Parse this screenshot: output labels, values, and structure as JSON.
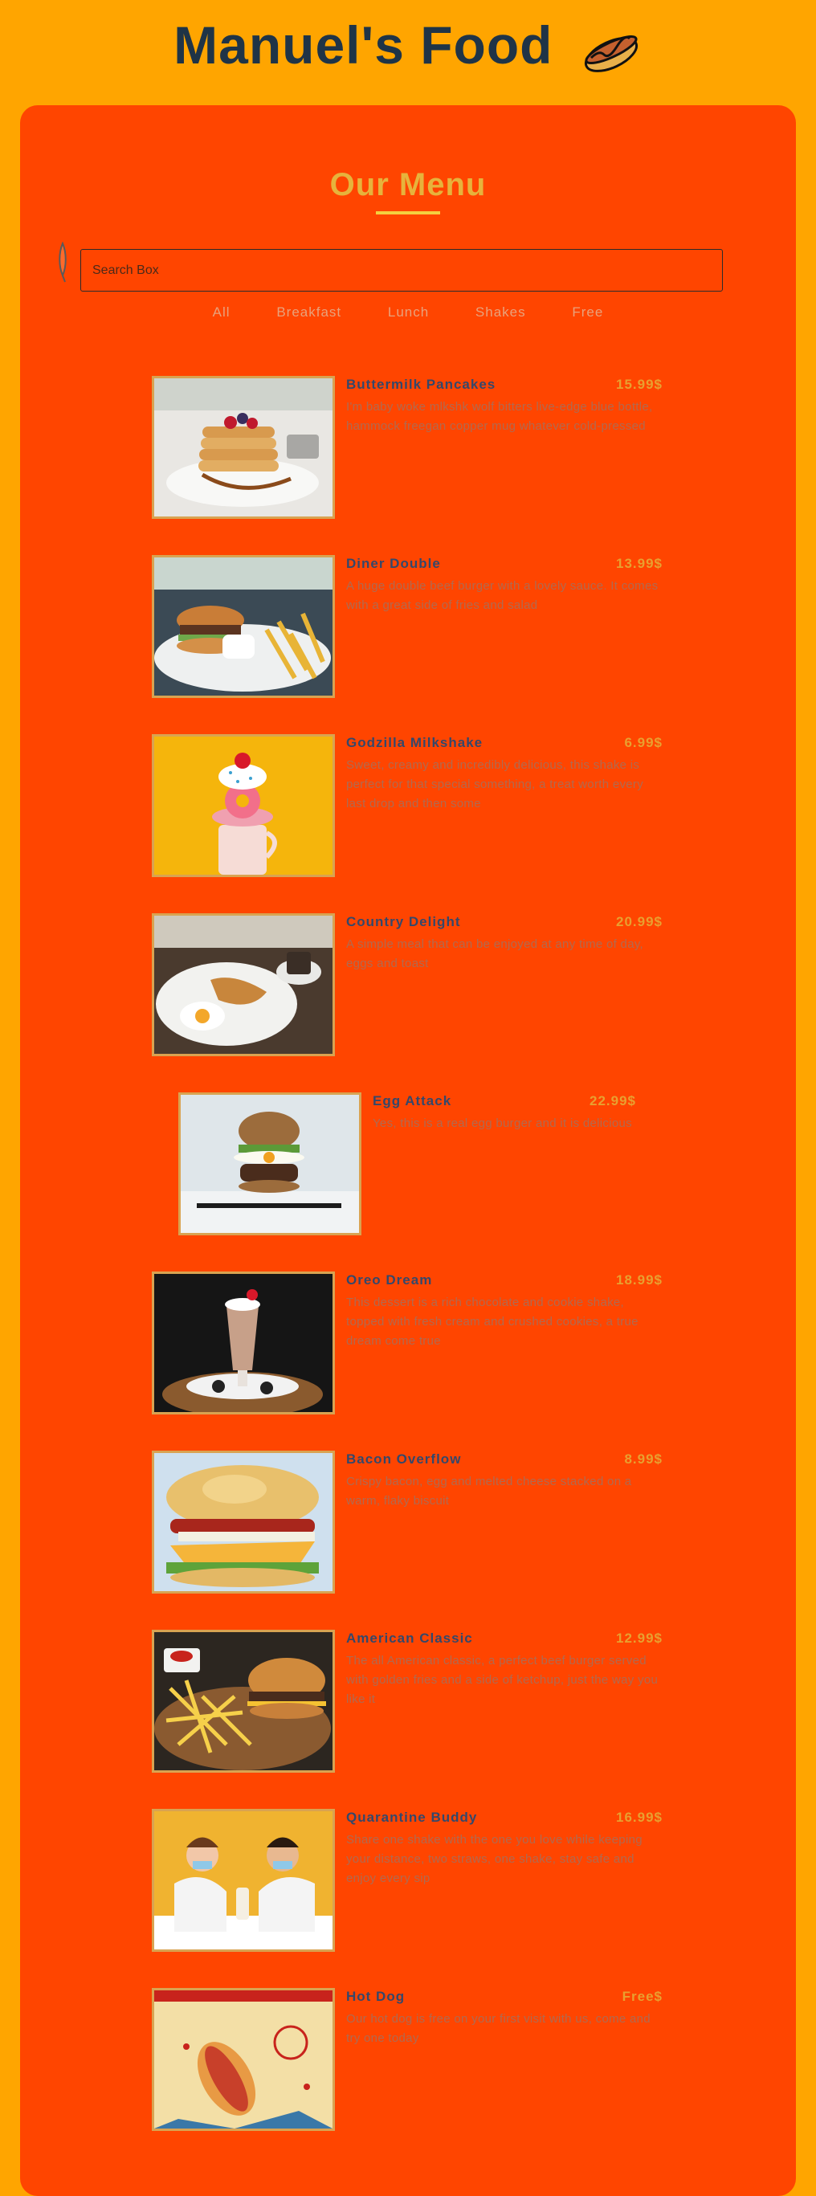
{
  "header": {
    "title": "Manuel's Food",
    "logo_icon": "hotdog-icon"
  },
  "menu": {
    "title": "Our Menu",
    "search": {
      "placeholder": "Search Box",
      "icon": "search-icon"
    },
    "filters": [
      "All",
      "Breakfast",
      "Lunch",
      "Shakes",
      "Free"
    ]
  },
  "colors": {
    "page_background": "#ffa500",
    "panel_background": "#ff4500",
    "title_text": "#1f3447",
    "heading_text": "#e6b33c",
    "item_name": "#34486b",
    "item_price": "#e8a030"
  },
  "items": [
    {
      "name": "Buttermilk Pancakes",
      "price": "15.99$",
      "photo": "pancakes-photo",
      "desc": "I'm baby woke mlkshk wolf bitters live-edge blue bottle, hammock freegan copper mug whatever cold-pressed"
    },
    {
      "name": "Diner Double",
      "price": "13.99$",
      "photo": "burger-fries-photo",
      "desc": "A huge double beef burger with a lovely sauce. It comes with a great side of fries and salad"
    },
    {
      "name": "Godzilla Milkshake",
      "price": "6.99$",
      "photo": "milkshake-photo",
      "desc": "Sweet, creamy and incredibly delicious, this shake is perfect for that special something, a treat worth every last drop and then some"
    },
    {
      "name": "Country Delight",
      "price": "20.99$",
      "photo": "breakfast-plate-photo",
      "desc": "A simple meal that can be enjoyed at any time of day, eggs and toast"
    },
    {
      "name": "Egg Attack",
      "price": "22.99$",
      "photo": "egg-burger-photo",
      "desc": "Yes, this is a real egg burger and it is delicious"
    },
    {
      "name": "Oreo Dream",
      "price": "18.99$",
      "photo": "oreo-shake-photo",
      "desc": "This dessert is a rich chocolate and cookie shake, topped with fresh cream and crushed cookies, a true dream come true"
    },
    {
      "name": "Bacon Overflow",
      "price": "8.99$",
      "photo": "bacon-sandwich-photo",
      "desc": "Crispy bacon, egg and melted cheese stacked on a warm, flaky biscuit"
    },
    {
      "name": "American Classic",
      "price": "12.99$",
      "photo": "classic-burger-photo",
      "desc": "The all American classic, a perfect beef burger served with golden fries and a side of ketchup, just the way you like it"
    },
    {
      "name": "Quarantine Buddy",
      "price": "16.99$",
      "photo": "couple-shake-photo",
      "desc": "Share one shake with the one you love while keeping your distance, two straws, one shake, stay safe and enjoy every sip"
    },
    {
      "name": "Hot Dog",
      "price": "Free$",
      "photo": "hotdog-poster-photo",
      "desc": "Our hot dog is free on your first visit with us, come and try one today"
    }
  ]
}
